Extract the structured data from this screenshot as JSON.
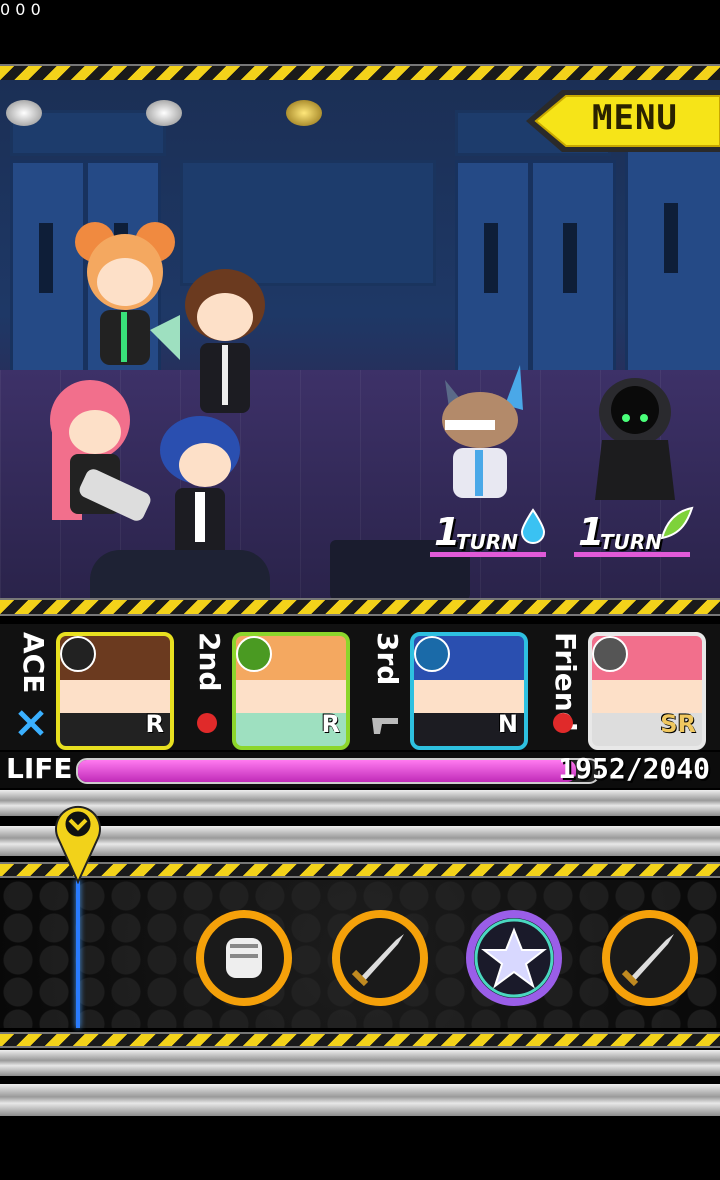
{
  "counters": [
    {
      "icon": "silver-medal-icon",
      "value": "0"
    },
    {
      "icon": "silver-medal-icon",
      "value": "0"
    },
    {
      "icon": "gold-medal-icon",
      "value": "0"
    }
  ],
  "menu": {
    "label": "MENU"
  },
  "enemies": [
    {
      "turn_number": "1",
      "turn_label": "TURN",
      "element": "water-drop-icon"
    },
    {
      "turn_number": "1",
      "turn_label": "TURN",
      "element": "leaf-icon"
    }
  ],
  "party": [
    {
      "slot": "ACE",
      "rarity": "R",
      "element": "lightning-icon",
      "weapon": "swords-icon",
      "frame_color": "#e8e020"
    },
    {
      "slot": "2nd",
      "rarity": "R",
      "element": "leaf-icon",
      "weapon": "fist-icon",
      "frame_color": "#8cd62c"
    },
    {
      "slot": "3rd",
      "rarity": "N",
      "element": "water-drop-icon",
      "weapon": "gun-icon",
      "frame_color": "#2ec0e0"
    },
    {
      "slot": "Friend",
      "rarity": "SR",
      "element": "compass-icon",
      "weapon": "fist-icon",
      "frame_color": "#e8e8e8"
    }
  ],
  "life": {
    "label": "LIFE",
    "value": "1952/2040",
    "fraction": 0.957
  },
  "commands": [
    {
      "icon": "fist-icon",
      "ring": "#f5a10a"
    },
    {
      "icon": "sword-icon",
      "ring": "#f5a10a"
    },
    {
      "icon": "star-icon",
      "ring": "#9a5ee8"
    },
    {
      "icon": "sword-icon",
      "ring": "#f5a10a"
    }
  ]
}
